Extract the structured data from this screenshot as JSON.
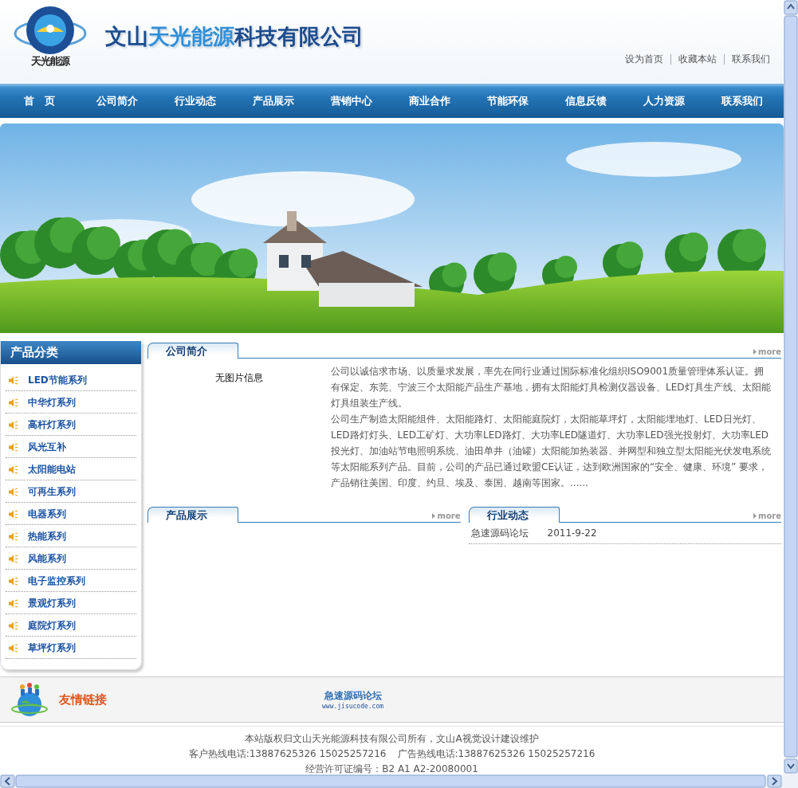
{
  "header": {
    "logo_caption": "天光能源",
    "title_parts": [
      {
        "text": "文山",
        "highlight": false
      },
      {
        "text": "天光能源",
        "highlight": true
      },
      {
        "text": "科技有限公司",
        "highlight": false
      }
    ],
    "top_links": [
      "设为首页",
      "收藏本站",
      "联系我们"
    ]
  },
  "nav": {
    "items": [
      "首　页",
      "公司简介",
      "行业动态",
      "产品展示",
      "营销中心",
      "商业合作",
      "节能环保",
      "信息反馈",
      "人力资源",
      "联系我们"
    ]
  },
  "sidebar": {
    "title": "产品分类",
    "items": [
      "LED节能系列",
      "中华灯系列",
      "高杆灯系列",
      "风光互补",
      "太阳能电站",
      "可再生系列",
      "电器系列",
      "热能系列",
      "风能系列",
      "电子监控系列",
      "景观灯系列",
      "庭院灯系列",
      "草坪灯系列"
    ]
  },
  "about": {
    "title": "公司简介",
    "more": "more",
    "image_note": "无图片信息",
    "paragraphs": [
      "公司以诚信求市场、以质量求发展，率先在同行业通过国际标准化组织ISO9001质量管理体系认证。拥有保定、东莞、宁波三个太阳能产品生产基地，拥有太阳能灯具检测仪器设备、LED灯具生产线、太阳能灯具组装生产线。",
      "公司生产制造太阳能组件、太阳能路灯、太阳能庭院灯，太阳能草坪灯，太阳能埋地灯、LED日光灯、LED路灯灯头、LED工矿灯、大功率LED路灯、大功率LED隧道灯、大功率LED强光投射灯、大功率LED投光灯、加油站节电照明系统、油田单井（油罐）太阳能加热装器、并网型和独立型太阳能光伏发电系统等太阳能系列产品。目前，公司的产品已通过欧盟CE认证，达到欧洲国家的“安全、健康、环境” 要求，产品销往美国、印度、约旦、埃及、泰国、越南等国家。......"
    ]
  },
  "products": {
    "title": "产品展示",
    "more": "more"
  },
  "news": {
    "title": "行业动态",
    "more": "more",
    "items": [
      {
        "title": "急速源码论坛",
        "date": "2011-9-22"
      }
    ]
  },
  "friend_links": {
    "title": "友情链接",
    "links": [
      {
        "name": "急速源码论坛",
        "url": "www.jisucode.com"
      }
    ]
  },
  "footer": {
    "lines": [
      [
        "本站版权归文山天光能源科技有限公司所有，文山A视觉设计建设维护"
      ],
      [
        "客户热线电话:13887625326 15025257216",
        "广告热线电话:13887625326 15025257216"
      ],
      [
        "经营许可证编号：B2 A1 A2-20080001"
      ]
    ]
  }
}
